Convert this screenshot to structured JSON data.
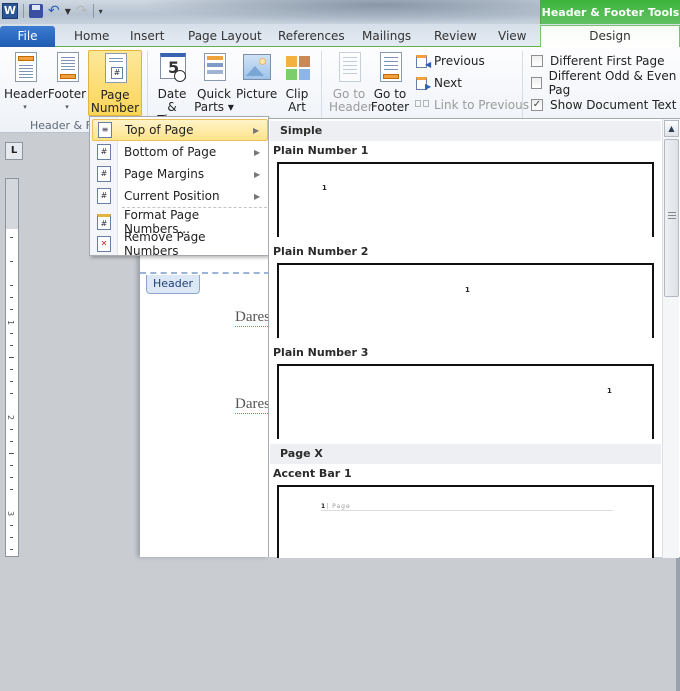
{
  "quick_access": {
    "app_icon": "W",
    "icons": [
      "word-app-icon",
      "save-icon",
      "undo-icon",
      "redo-icon",
      "customize-qat-icon"
    ]
  },
  "contextual_tab_group": "Header & Footer Tools",
  "tabs": [
    {
      "label": "File"
    },
    {
      "label": "Home"
    },
    {
      "label": "Insert"
    },
    {
      "label": "Page Layout"
    },
    {
      "label": "References"
    },
    {
      "label": "Mailings"
    },
    {
      "label": "Review"
    },
    {
      "label": "View"
    },
    {
      "label": "Design",
      "active": true
    }
  ],
  "ribbon": {
    "group_header_footer": {
      "label": "Header & F",
      "buttons": [
        {
          "line1": "Header",
          "line2": "▾"
        },
        {
          "line1": "Footer",
          "line2": "▾"
        },
        {
          "line1": "Page",
          "line2": "Number ▾",
          "active": true
        }
      ]
    },
    "group_insert": {
      "buttons": [
        {
          "line1": "Date",
          "line2": "& Time"
        },
        {
          "line1": "Quick",
          "line2": "Parts ▾"
        },
        {
          "line1": "Picture",
          "line2": ""
        },
        {
          "line1": "Clip",
          "line2": "Art"
        }
      ]
    },
    "group_navigation": {
      "buttons": [
        {
          "line1": "Go to",
          "line2": "Header",
          "disabled": true
        },
        {
          "line1": "Go to",
          "line2": "Footer"
        }
      ],
      "small_buttons": [
        {
          "label": "Previous"
        },
        {
          "label": "Next"
        },
        {
          "label": "Link to Previous",
          "disabled": true
        }
      ]
    },
    "group_options": {
      "checkboxes": [
        {
          "label": "Different First Page",
          "checked": false
        },
        {
          "label": "Different Odd & Even Pag",
          "checked": false
        },
        {
          "label": "Show Document Text",
          "checked": true
        }
      ]
    }
  },
  "dropdown_menu": {
    "items": [
      {
        "label": "Top of Page",
        "submenu": true,
        "highlighted": true
      },
      {
        "label": "Bottom of Page",
        "submenu": true
      },
      {
        "label": "Page Margins",
        "submenu": true
      },
      {
        "label": "Current Position",
        "submenu": true
      },
      {
        "label": "Format Page Numbers...",
        "submenu": false
      },
      {
        "label": "Remove Page Numbers",
        "submenu": false
      }
    ]
  },
  "gallery": {
    "categories": [
      {
        "title": "Simple",
        "items": [
          {
            "name": "Plain Number 1",
            "preview": "1"
          },
          {
            "name": "Plain Number 2",
            "preview": "1"
          },
          {
            "name": "Plain Number 3",
            "preview": "1"
          }
        ]
      },
      {
        "title": "Page X",
        "items": [
          {
            "name": "Accent Bar 1",
            "preview_number": "1",
            "preview_text": "| Page"
          }
        ]
      }
    ]
  },
  "document": {
    "header_tag": "Header",
    "lines": [
      "Dares",
      "Dares"
    ]
  },
  "ruler": {
    "corner_glyph": "L",
    "numbers": [
      "1",
      "2",
      "3"
    ]
  }
}
